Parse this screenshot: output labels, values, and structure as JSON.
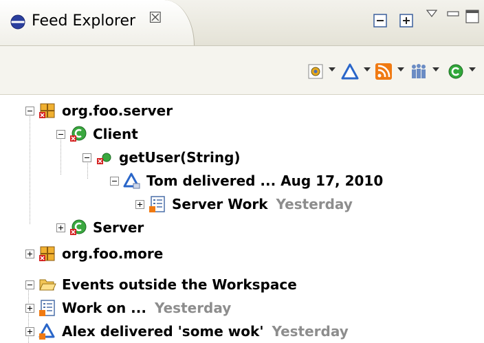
{
  "tab": {
    "title": "Feed Explorer",
    "close_glyph": "☒"
  },
  "view_buttons": [
    "collapse-all-icon",
    "expand-all-icon",
    "view-menu-icon",
    "minimize-icon",
    "maximize-icon"
  ],
  "toolbar": [
    "filter-icon",
    "delivery-icon",
    "rss-feed-icon",
    "group-people-icon",
    "refresh-icon"
  ],
  "tree": [
    {
      "label": "org.foo.server",
      "icon": "package-icon",
      "expanded": true
    },
    {
      "label": "Client",
      "icon": "class-icon",
      "expanded": true
    },
    {
      "label": "getUser(String)",
      "icon": "method-icon",
      "expanded": true
    },
    {
      "label": "Tom delivered ... Aug 17, 2010",
      "icon": "delivery-icon",
      "expanded": true
    },
    {
      "label": "Server Work",
      "icon": "work-item-icon",
      "expanded": false,
      "time": "Yesterday"
    },
    {
      "label": "Server",
      "icon": "class-icon",
      "expanded": false
    },
    {
      "label": "org.foo.more",
      "icon": "package-icon",
      "expanded": false
    },
    {
      "label": "Events outside the Workspace",
      "icon": "folder-icon",
      "expanded": true
    },
    {
      "label": "Work on ...",
      "icon": "work-item-icon",
      "expanded": false,
      "time": "Yesterday"
    },
    {
      "label": "Alex delivered 'some wok'",
      "icon": "delivery-icon",
      "expanded": false,
      "time": "Yesterday"
    }
  ],
  "colors": {
    "timestamp": "#8d8d8d",
    "accent_blue": "#2a66c9",
    "rss_orange": "#f07a12",
    "error_red": "#d42020"
  }
}
